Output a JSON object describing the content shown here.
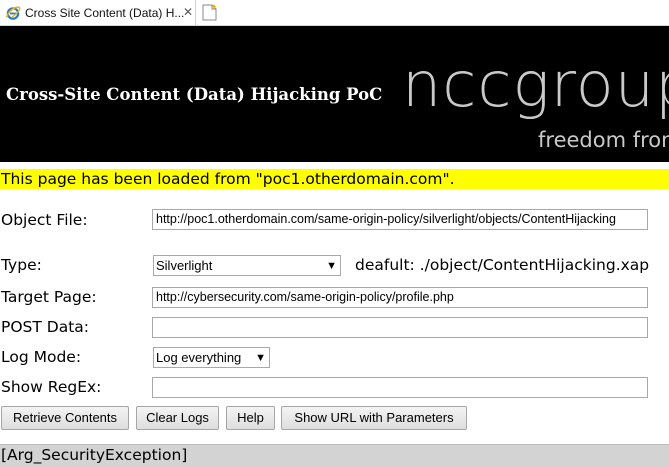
{
  "browser": {
    "tab_title": "Cross Site Content (Data) H...",
    "tab_close": "✕"
  },
  "banner": {
    "title": "Cross-Site Content (Data) Hijacking PoC",
    "logo_text": "nccgroup",
    "tagline": "freedom from"
  },
  "notice": "This page has been loaded from \"poc1.otherdomain.com\".",
  "form": {
    "object_file_label": "Object File:",
    "object_file_value": "http://poc1.otherdomain.com/same-origin-policy/silverlight/objects/ContentHijacking",
    "type_label": "Type:",
    "type_value": "Silverlight",
    "type_hint": "deafult: ./object/ContentHijacking.xap",
    "target_page_label": "Target Page:",
    "target_page_value": "http://cybersecurity.com/same-origin-policy/profile.php",
    "post_data_label": "POST Data:",
    "post_data_value": "",
    "log_mode_label": "Log Mode:",
    "log_mode_value": "Log everything",
    "show_regex_label": "Show RegEx:",
    "show_regex_value": ""
  },
  "buttons": {
    "retrieve": "Retrieve Contents",
    "clear_logs": "Clear Logs",
    "help": "Help",
    "show_url": "Show URL with Parameters"
  },
  "status": "[Arg_SecurityException]",
  "colors": {
    "notice_bg": "#ffff00",
    "banner_bg": "#000000",
    "status_bg": "#d3d3d3"
  }
}
